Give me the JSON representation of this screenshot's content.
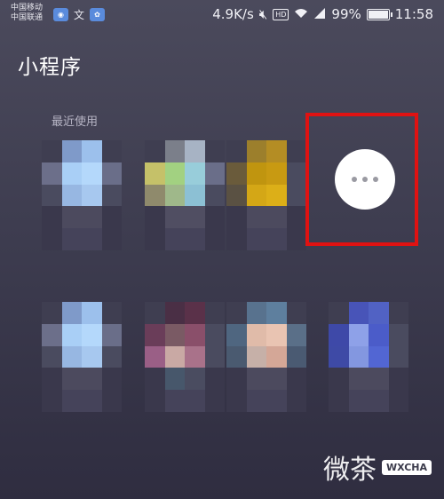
{
  "status_bar": {
    "carrier_1": "中国移动",
    "carrier_2": "中国联通",
    "net_speed": "4.9K/s",
    "hd_label": "HD",
    "battery_percent": "99%",
    "battery_level": 0.99,
    "time": "11:58",
    "icons": [
      "app-notification-icon",
      "text-notification-icon",
      "baidu-icon",
      "mute-icon",
      "wifi-icon",
      "signal-icon"
    ]
  },
  "page": {
    "title": "小程序"
  },
  "recent": {
    "label": "最近使用",
    "more_button": {
      "icon": "more-dots-icon"
    }
  },
  "apps": [
    {
      "palette": [
        "#3f3e51",
        "#7f9ac9",
        "#9cc0ec",
        "#3f3e51",
        "#6c6f8a",
        "#a9cff6",
        "#b4d8fb",
        "#6a6e89",
        "#4a4b5f",
        "#97b7e2",
        "#a7c8ef",
        "#4a4b5f",
        "#3a384c",
        "#4c4a5e",
        "#4c4a5e",
        "#3a384c",
        "#3a384c",
        "#45435a",
        "#45435a",
        "#3a384c"
      ]
    },
    {
      "palette": [
        "#3f3e51",
        "#7b7f8a",
        "#a7b3c4",
        "#3f3e51",
        "#c5c169",
        "#a2d181",
        "#98cdda",
        "#6a6e89",
        "#8f8a6c",
        "#9fb88a",
        "#8cc0d4",
        "#4a4b5f",
        "#3a384c",
        "#504e62",
        "#504e62",
        "#3a384c",
        "#3a384c",
        "#45435a",
        "#45435a",
        "#3a384c"
      ]
    },
    {
      "palette": [
        "#3f3e51",
        "#9c7f2c",
        "#b48d24",
        "#3f3e51",
        "#6a5b3b",
        "#c0950f",
        "#c89a12",
        "#4a4b5f",
        "#5a5143",
        "#d4a716",
        "#dcaf18",
        "#4a4b5f",
        "#3a384c",
        "#4c4a5e",
        "#4c4a5e",
        "#3a384c",
        "#3a384c",
        "#45435a",
        "#45435a",
        "#3a384c"
      ]
    },
    {
      "palette": [
        "#3f3e51",
        "#7f9ac9",
        "#9cc0ec",
        "#3f3e51",
        "#6c6f8a",
        "#a9cff6",
        "#b4d8fb",
        "#6a6e89",
        "#4a4b5f",
        "#97b7e2",
        "#a7c8ef",
        "#4a4b5f",
        "#3a384c",
        "#4c4a5e",
        "#4c4a5e",
        "#3a384c",
        "#3a384c",
        "#45435a",
        "#45435a",
        "#3a384c"
      ]
    },
    {
      "palette": [
        "#3f3e51",
        "#4a2f45",
        "#5a3149",
        "#3f3e51",
        "#6a3d59",
        "#7a5a64",
        "#8a4f6a",
        "#4a4b5f",
        "#9a5f86",
        "#c9a9a4",
        "#a9728a",
        "#4a4b5f",
        "#3a384c",
        "#47576b",
        "#4a4c60",
        "#3a384c",
        "#3a384c",
        "#45435a",
        "#45435a",
        "#3a384c"
      ]
    },
    {
      "palette": [
        "#3f3e51",
        "#58728e",
        "#5e7f9e",
        "#3f3e51",
        "#4f6680",
        "#e0bba9",
        "#e9c4b2",
        "#5a6f88",
        "#4a5a70",
        "#c6b0a8",
        "#d4a797",
        "#4a5a72",
        "#3a384c",
        "#4c4a5e",
        "#4c4a5e",
        "#3a384c",
        "#3a384c",
        "#45435a",
        "#45435a",
        "#3a384c"
      ]
    },
    {
      "palette": [
        "#3f3e51",
        "#4854b8",
        "#5162c4",
        "#3f3e51",
        "#3e49a8",
        "#8ea1e8",
        "#4b5cc9",
        "#4a4b5f",
        "#3e4aa6",
        "#8397e0",
        "#5266d3",
        "#4a4b5f",
        "#3a384c",
        "#4c4a5e",
        "#4c4a5e",
        "#3a384c",
        "#3a384c",
        "#45435a",
        "#45435a",
        "#3a384c"
      ]
    }
  ],
  "watermark": {
    "text": "微茶",
    "badge": "WXCHA"
  },
  "colors": {
    "highlight": "#e01212",
    "background_top": "#4b4a5c",
    "background_bottom": "#2f2d40"
  }
}
